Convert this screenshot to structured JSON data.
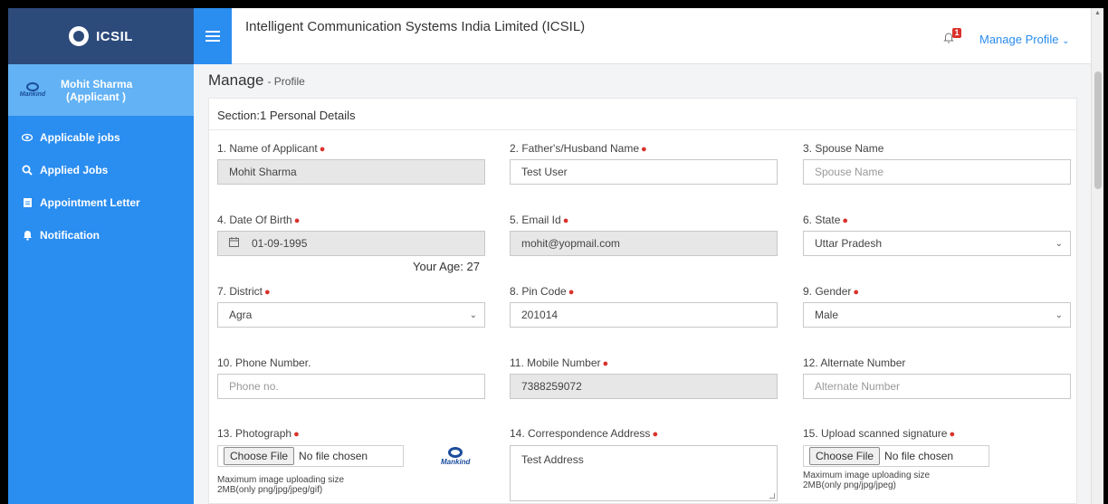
{
  "brand": {
    "name": "ICSIL"
  },
  "user": {
    "name": "Mohit Sharma",
    "role": "(Applicant )",
    "logo_text": "Mankind"
  },
  "nav": [
    {
      "label": "Applicable jobs",
      "icon": "eye-icon"
    },
    {
      "label": "Applied Jobs",
      "icon": "search-icon"
    },
    {
      "label": "Appointment Letter",
      "icon": "document-icon"
    },
    {
      "label": "Notification",
      "icon": "bell-icon"
    }
  ],
  "header": {
    "title": "Intelligent Communication Systems India Limited (ICSIL)",
    "notification_count": "1",
    "profile_menu": "Manage Profile"
  },
  "page": {
    "title": "Manage",
    "subtitle": "- Profile"
  },
  "section": {
    "title": "Section:1 Personal Details"
  },
  "fields": {
    "name": {
      "label": "1. Name of Applicant",
      "value": "Mohit Sharma"
    },
    "father": {
      "label": "2. Father's/Husband Name",
      "value": "Test User"
    },
    "spouse": {
      "label": "3. Spouse Name",
      "placeholder": "Spouse Name"
    },
    "dob": {
      "label": "4. Date Of Birth",
      "value": "01-09-1995",
      "age_note": "Your Age: 27"
    },
    "email": {
      "label": "5. Email Id",
      "value": "mohit@yopmail.com"
    },
    "state": {
      "label": "6. State",
      "value": "Uttar Pradesh"
    },
    "district": {
      "label": "7. District",
      "value": "Agra"
    },
    "pincode": {
      "label": "8. Pin Code",
      "value": "201014"
    },
    "gender": {
      "label": "9. Gender",
      "value": "Male"
    },
    "phone": {
      "label": "10. Phone Number.",
      "placeholder": "Phone no."
    },
    "mobile": {
      "label": "11. Mobile Number",
      "value": "7388259072"
    },
    "alternate": {
      "label": "12. Alternate Number",
      "placeholder": "Alternate Number"
    },
    "photo": {
      "label": "13. Photograph",
      "button": "Choose File",
      "status": "No file chosen",
      "hint_line1": "Maximum image uploading size",
      "hint_line2": "2MB(only png/jpg/jpeg/gif)",
      "logo_text": "Mankind"
    },
    "address": {
      "label": "14. Correspondence Address",
      "value": "Test Address"
    },
    "signature": {
      "label": "15. Upload scanned signature",
      "button": "Choose File",
      "status": "No file chosen",
      "hint_line1": "Maximum image uploading size",
      "hint_line2": "2MB(only png/jpg/jpeg)"
    }
  },
  "colors": {
    "sidebar": "#2a8df0",
    "brand_bar": "#2c4a7a",
    "user_box": "#62b2f5",
    "required": "#d9322b"
  }
}
